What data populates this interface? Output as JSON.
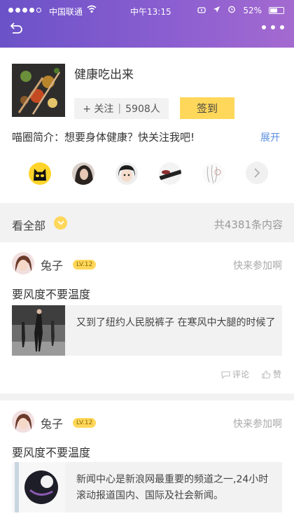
{
  "status_bar": {
    "carrier": "中国联通",
    "time": "中午13:15",
    "battery": "52%"
  },
  "circle": {
    "title": "健康吃出来",
    "follow_label": "+ 关注",
    "follower_count": "5908人",
    "signin_label": "签到",
    "intro": "喵圈简介：想要身体健康？快关注我吧!",
    "expand_label": "展开",
    "member_avatars": [
      "cat-avatar",
      "girl-hair-avatar",
      "child-avatar",
      "hat-avatar",
      "sketch-avatar"
    ]
  },
  "filter": {
    "label": "看全部",
    "count_text": "共4381条内容"
  },
  "posts": [
    {
      "author": "兔子",
      "level": "LV.12",
      "join_text": "快来参加啊",
      "title": "要风度不要温度",
      "excerpt": "又到了纽约人民脱裤子 在寒风中大腿的时候了",
      "comment_label": "评论",
      "like_label": "赞"
    },
    {
      "author": "兔子",
      "level": "LV.12",
      "join_text": "快来参加啊",
      "title": "要风度不要温度",
      "excerpt": "新闻中心是新浪网最重要的频道之一,24小时滚动报道国内、国际及社会新闻。"
    }
  ],
  "colors": {
    "header_start": "#6b52c8",
    "header_end": "#a46ad0",
    "accent_yellow": "#ffd75a",
    "link_blue": "#5b8fe0"
  }
}
